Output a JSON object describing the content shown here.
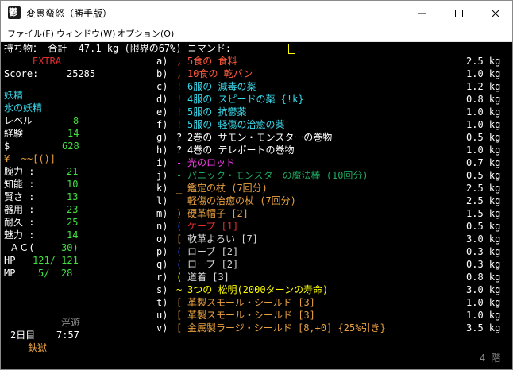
{
  "window": {
    "title": "変愚蛮怒（勝手版）",
    "icon_name": "game-icon"
  },
  "menu": [
    "ファイル(F)",
    "ウィンドウ(W)",
    "オプション(O)"
  ],
  "header": {
    "text": "持ち物： 合計  47.1 kg (限界の67%) コマンド:"
  },
  "stats": {
    "extra": "EXTRA",
    "score_label": "Score:",
    "score_value": "25285",
    "race": "妖精",
    "title": "氷の妖精",
    "level_label": "レベル",
    "level_value": "8",
    "exp_label": "経験",
    "exp_value": "14",
    "gold_label": "$",
    "gold_value": "628",
    "equip": "¥  ~~[()]",
    "str_label": "腕力 :",
    "str_value": "21",
    "int_label": "知能 :",
    "int_value": "10",
    "wis_label": "賢さ :",
    "wis_value": "13",
    "dex_label": "器用 :",
    "dex_value": "23",
    "con_label": "耐久 :",
    "con_value": "25",
    "chr_label": "魅力 :",
    "chr_value": "14",
    "ac_label": " ＡＣ(",
    "ac_value": "30)",
    "hp_label": "HP",
    "hp_value": "121/ 121",
    "mp_label": "MP",
    "mp_value": "5/  28"
  },
  "status": {
    "levitation": "浮遊",
    "day": "2日目",
    "time": "7:57",
    "location": "鉄獄",
    "depth": "4 階"
  },
  "inventory": [
    {
      "slot": "a)",
      "sym": ",",
      "name": "5食の 食料",
      "weight": "2.5 kg",
      "sym_color": "#ff5a3c",
      "name_color": "#ff5a3c"
    },
    {
      "slot": "b)",
      "sym": ",",
      "name": "10食の 乾パン",
      "weight": "1.0 kg",
      "sym_color": "#ff5a3c",
      "name_color": "#ff5a3c"
    },
    {
      "slot": "c)",
      "sym": "!",
      "name": "6服の 減毒の薬",
      "weight": "1.2 kg",
      "sym_color": "#e03030",
      "name_color": "#3ad6e8"
    },
    {
      "slot": "d)",
      "sym": "!",
      "name": "4服の スピードの薬 {!k}",
      "weight": "0.8 kg",
      "sym_color": "#3ad6e8",
      "name_color": "#3ad6e8"
    },
    {
      "slot": "e)",
      "sym": "!",
      "name": "5服の 抗鬱薬",
      "weight": "1.0 kg",
      "sym_color": "#ff3df0",
      "name_color": "#3ad6e8"
    },
    {
      "slot": "f)",
      "sym": "!",
      "name": "5服の 軽傷の治癒の薬",
      "weight": "1.0 kg",
      "sym_color": "#ff3df0",
      "name_color": "#3ad6e8"
    },
    {
      "slot": "g)",
      "sym": "?",
      "name": "2巻の サモン・モンスターの巻物",
      "weight": "0.5 kg",
      "sym_color": "#ffffff",
      "name_color": "#ffffff"
    },
    {
      "slot": "h)",
      "sym": "?",
      "name": "4巻の テレポートの巻物",
      "weight": "1.0 kg",
      "sym_color": "#ffffff",
      "name_color": "#ffffff"
    },
    {
      "slot": "i)",
      "sym": "-",
      "name": "光のロッド",
      "weight": "0.7 kg",
      "sym_color": "#ff3df0",
      "name_color": "#ff3df0"
    },
    {
      "slot": "j)",
      "sym": "-",
      "name": "パニック・モンスターの魔法棒 (10回分)",
      "weight": "0.5 kg",
      "sym_color": "#1fa860",
      "name_color": "#1fa860"
    },
    {
      "slot": "k)",
      "sym": "_",
      "name": "鑑定の杖 (7回分)",
      "weight": "2.5 kg",
      "sym_color": "#e8a040",
      "name_color": "#e8a040"
    },
    {
      "slot": "l)",
      "sym": "_",
      "name": "軽傷の治癒の杖 (7回分)",
      "weight": "2.5 kg",
      "sym_color": "#e03030",
      "name_color": "#e8a040"
    },
    {
      "slot": "m)",
      "sym": ")",
      "name": "硬革帽子 [2]",
      "weight": "1.5 kg",
      "sym_color": "#e8a040",
      "name_color": "#e8a040"
    },
    {
      "slot": "n)",
      "sym": "(",
      "name": "ケープ [1]",
      "weight": "0.5 kg",
      "sym_color": "#2a50ff",
      "name_color": "#e03030"
    },
    {
      "slot": "o)",
      "sym": "[",
      "name": "軟革よろい [7]",
      "weight": "3.0 kg",
      "sym_color": "#e8a040",
      "name_color": "#d8d8d8"
    },
    {
      "slot": "p)",
      "sym": "(",
      "name": "ローブ [2]",
      "weight": "0.3 kg",
      "sym_color": "#2a50ff",
      "name_color": "#d8d8d8"
    },
    {
      "slot": "q)",
      "sym": "(",
      "name": "ローブ [2]",
      "weight": "0.3 kg",
      "sym_color": "#2a50ff",
      "name_color": "#d8d8d8"
    },
    {
      "slot": "r)",
      "sym": "(",
      "name": "道着 [3]",
      "weight": "0.8 kg",
      "sym_color": "#ffff00",
      "name_color": "#d8d8d8"
    },
    {
      "slot": "s)",
      "sym": "~",
      "name": "3つの 松明(2000ターンの寿命)",
      "weight": "3.0 kg",
      "sym_color": "#ffff00",
      "name_color": "#ffff00"
    },
    {
      "slot": "t)",
      "sym": "[",
      "name": "革製スモール・シールド [3]",
      "weight": "1.0 kg",
      "sym_color": "#e8a040",
      "name_color": "#e8a040"
    },
    {
      "slot": "u)",
      "sym": "[",
      "name": "革製スモール・シールド [3]",
      "weight": "1.0 kg",
      "sym_color": "#e8a040",
      "name_color": "#e8a040"
    },
    {
      "slot": "v)",
      "sym": "[",
      "name": "金属製ラージ・シールド [8,+0] {25%引き}",
      "weight": "3.5 kg",
      "sym_color": "#e8a040",
      "name_color": "#e8a040"
    }
  ],
  "colors": {
    "background": "#000000",
    "label": "#ffffff",
    "value_green": "#40e040",
    "race_cyan": "#3ad6e8",
    "extra_red": "#e03030",
    "cursor_yellow": "#ffff00",
    "depth_gray": "#8c8c8c"
  }
}
